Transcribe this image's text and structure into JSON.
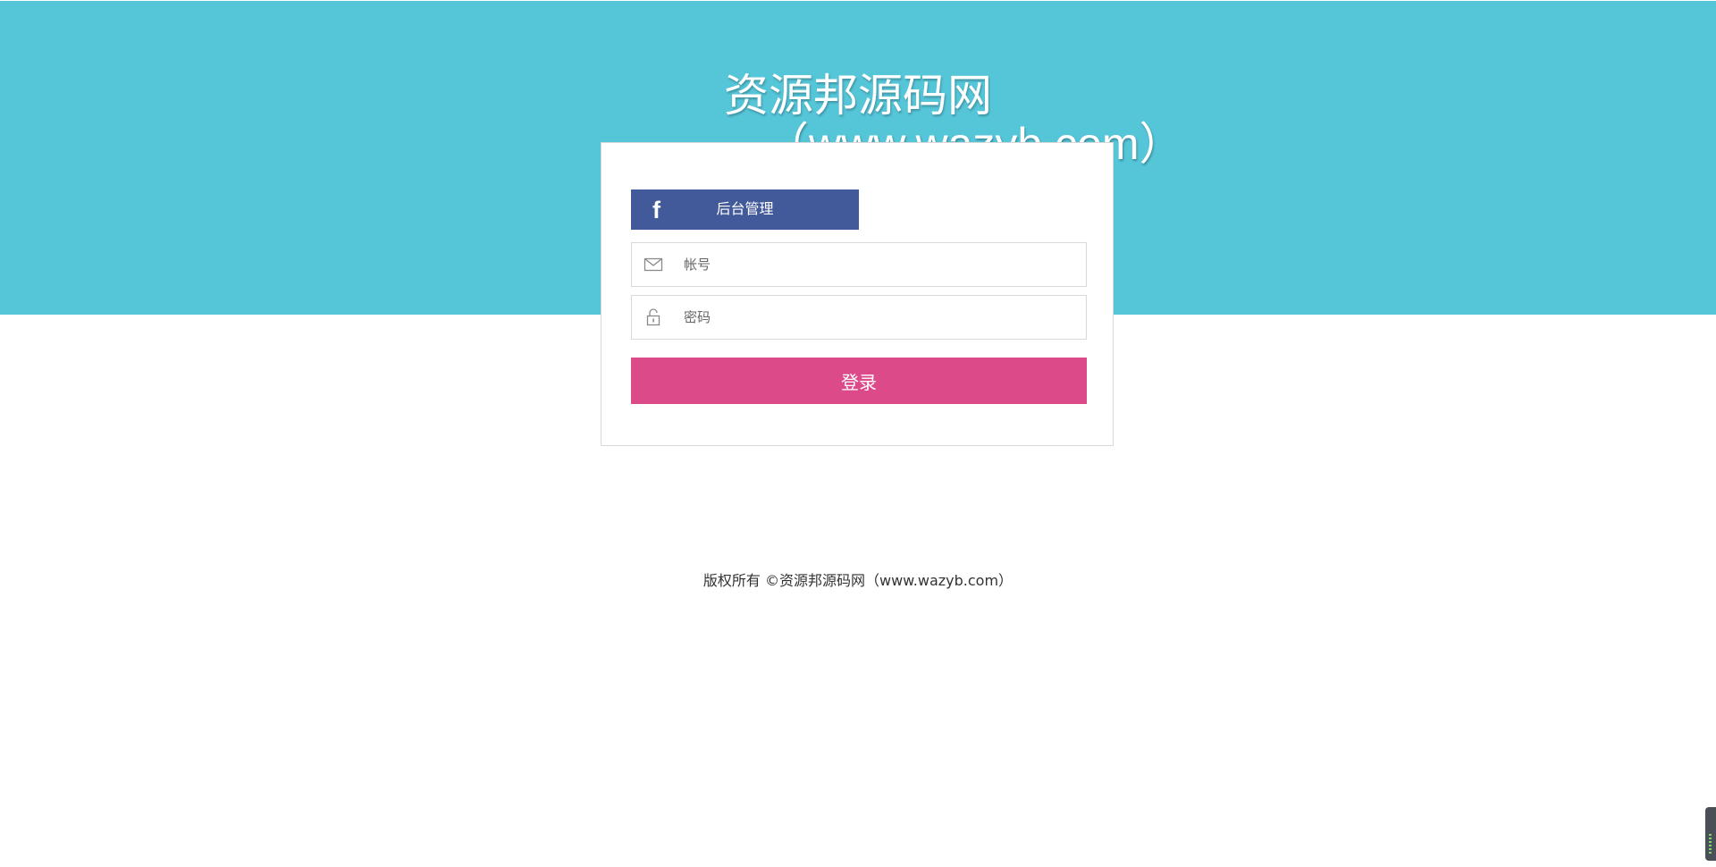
{
  "header": {
    "title": "资源邦源码网",
    "subtitle": "（www.wazyb.com）"
  },
  "login_card": {
    "admin_button": {
      "icon": "facebook-f-icon",
      "label": "后台管理"
    },
    "account_field": {
      "icon": "envelope-icon",
      "placeholder": "帐号",
      "value": ""
    },
    "password_field": {
      "icon": "lock-icon",
      "placeholder": "密码",
      "value": ""
    },
    "login_button": {
      "label": "登录"
    }
  },
  "footer": {
    "copyright": "版权所有 ©资源邦源码网（www.wazyb.com）"
  },
  "colors": {
    "banner": "#55c5d8",
    "admin_button": "#435a9a",
    "login_button": "#dd4a8a"
  }
}
